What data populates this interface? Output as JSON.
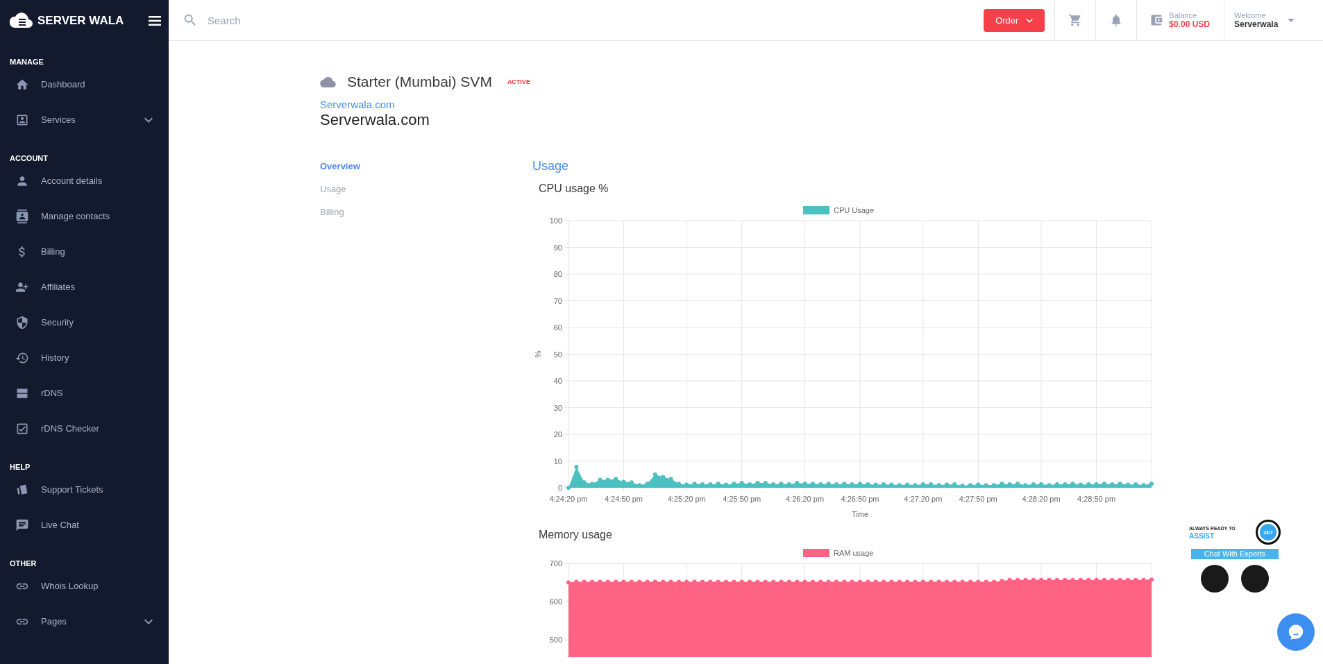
{
  "brand": {
    "name": "SERVER WALA"
  },
  "sidebar": {
    "sections": [
      {
        "heading": "MANAGE",
        "items": [
          {
            "label": "Dashboard",
            "has_submenu": false
          },
          {
            "label": "Services",
            "has_submenu": true
          }
        ]
      },
      {
        "heading": "ACCOUNT",
        "items": [
          {
            "label": "Account details",
            "has_submenu": false
          },
          {
            "label": "Manage contacts",
            "has_submenu": false
          },
          {
            "label": "Billing",
            "has_submenu": false
          },
          {
            "label": "Affiliates",
            "has_submenu": false
          },
          {
            "label": "Security",
            "has_submenu": false
          },
          {
            "label": "History",
            "has_submenu": false
          },
          {
            "label": "rDNS",
            "has_submenu": false
          },
          {
            "label": "rDNS Checker",
            "has_submenu": false
          }
        ]
      },
      {
        "heading": "HELP",
        "items": [
          {
            "label": "Support Tickets",
            "has_submenu": false
          },
          {
            "label": "Live Chat",
            "has_submenu": false
          }
        ]
      },
      {
        "heading": "OTHER",
        "items": [
          {
            "label": "Whois Lookup",
            "has_submenu": false
          },
          {
            "label": "Pages",
            "has_submenu": true
          }
        ]
      }
    ]
  },
  "header": {
    "search": {
      "placeholder": "Search"
    },
    "order_button": "Order",
    "balance": {
      "label": "Balance",
      "value": "$0.00 USD"
    },
    "user": {
      "greeting": "Welcome",
      "name": "Serverwala"
    }
  },
  "service": {
    "title": "Starter (Mumbai) SVM",
    "status": "ACTIVE",
    "domain_link": "Serverwala.com",
    "domain": "Serverwala.com"
  },
  "subnav": [
    {
      "label": "Overview",
      "selected": true
    },
    {
      "label": "Usage",
      "selected": false
    },
    {
      "label": "Billing",
      "selected": false
    }
  ],
  "usage": {
    "heading": "Usage",
    "charts": [
      {
        "title": "CPU usage %",
        "chart_data": {
          "type": "area",
          "grid": true,
          "xlabel": "Time",
          "ylabel": "%",
          "categories": [
            "4:24:20 pm",
            null,
            null,
            null,
            null,
            null,
            null,
            "4:24:50 pm",
            null,
            null,
            null,
            null,
            null,
            null,
            null,
            "4:25:20 pm",
            null,
            null,
            null,
            null,
            null,
            null,
            "4:25:50 pm",
            null,
            null,
            null,
            null,
            null,
            null,
            null,
            "4:26:20 pm",
            null,
            null,
            null,
            null,
            null,
            null,
            "4:26:50 pm",
            null,
            null,
            null,
            null,
            null,
            null,
            null,
            "4:27:20 pm",
            null,
            null,
            null,
            null,
            null,
            null,
            "4:27:50 pm",
            null,
            null,
            null,
            null,
            null,
            null,
            null,
            "4:28:20 pm",
            null,
            null,
            null,
            null,
            null,
            null,
            "4:28:50 pm",
            null,
            null,
            null,
            null,
            null,
            null,
            null
          ],
          "series": [
            {
              "name": "CPU Usage",
              "color": "#4bc0c0",
              "values": [
                0,
                7.8,
                2,
                1.5,
                3,
                3,
                3.3,
                2.2,
                2,
                1,
                1.5,
                5,
                4,
                3.3,
                1.5,
                1.2,
                1.5,
                1.3,
                1.3,
                1.5,
                1.2,
                1.5,
                1.8,
                1.3,
                1.8,
                1.8,
                1.3,
                1.5,
                1.3,
                1.8,
                1.5,
                1.5,
                1.3,
                1.5,
                1.3,
                1.5,
                1.3,
                1.5,
                1.3,
                1.2,
                1.3,
                1.2,
                1,
                1.2,
                1,
                1.3,
                1.3,
                1,
                1.2,
                1.3,
                0.8,
                1,
                1.2,
                1,
                1,
                1.5,
                1.3,
                1.5,
                1,
                1.3,
                1.3,
                1,
                1.3,
                1.3,
                1.5,
                1.2,
                1.3,
                1.3,
                1.5,
                1.3,
                1.5,
                1.2,
                1.3,
                1,
                1.5
              ]
            }
          ],
          "ylim": [
            0,
            100
          ],
          "yticks": [
            0,
            10,
            20,
            30,
            40,
            50,
            60,
            70,
            80,
            90,
            100
          ]
        }
      },
      {
        "title": "Memory usage",
        "chart_data": {
          "type": "area",
          "grid": true,
          "categories": [
            null,
            null,
            null,
            null,
            null,
            null,
            null,
            null,
            null,
            null,
            null,
            null,
            null,
            null,
            null,
            null,
            null,
            null,
            null,
            null,
            null,
            null,
            null,
            null,
            null,
            null,
            null,
            null,
            null,
            null,
            null,
            null,
            null,
            null,
            null,
            null,
            null,
            null,
            null,
            null,
            null,
            null,
            null,
            null,
            null,
            null,
            null,
            null,
            null,
            null,
            null,
            null,
            null,
            null,
            null,
            null,
            null,
            null,
            null,
            null,
            null,
            null,
            null,
            null,
            null,
            null,
            null,
            null,
            null,
            null,
            null,
            null,
            null,
            null,
            null
          ],
          "series": [
            {
              "name": "RAM usage",
              "color": "#ff6384",
              "values": [
                650,
                652,
                652,
                652,
                652,
                652,
                652,
                652,
                652,
                652,
                652,
                652,
                652,
                652,
                652,
                652,
                652,
                652,
                652,
                652,
                652,
                652,
                652,
                652,
                652,
                652,
                652,
                652,
                652,
                652,
                652,
                652,
                652,
                652,
                652,
                652,
                652,
                652,
                652,
                652,
                652,
                652,
                652,
                652,
                652,
                652,
                652,
                652,
                652,
                652,
                652,
                652,
                652,
                652,
                652,
                654,
                657,
                657,
                657,
                657,
                657,
                657,
                657,
                657,
                657,
                657,
                657,
                657,
                657,
                657,
                657,
                657,
                657,
                657,
                658
              ]
            }
          ],
          "ylim": [
            455,
            700
          ],
          "yticks": [
            500,
            600,
            700
          ]
        }
      }
    ]
  },
  "chat_promo": {
    "tagline": "ALWAYS READY TO",
    "highlight": "ASSIST",
    "badge": "24/7",
    "button": "Chat With Experts"
  }
}
